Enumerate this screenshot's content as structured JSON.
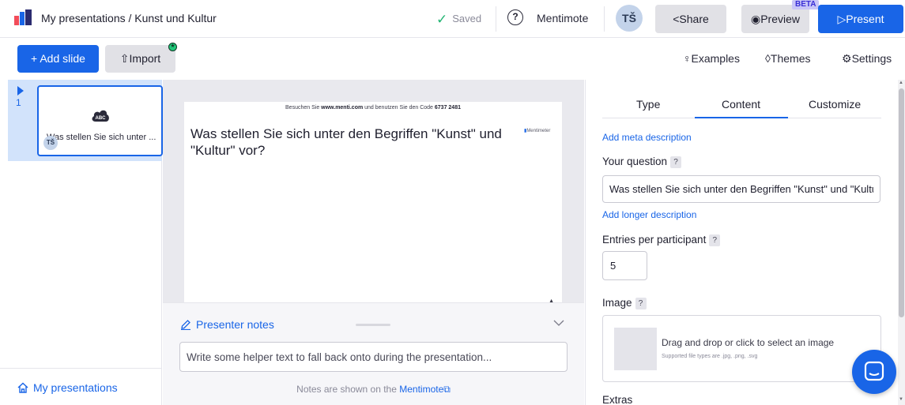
{
  "header": {
    "breadcrumb": "My presentations / Kunst und Kultur",
    "saved": "Saved",
    "mentimote": "Mentimote",
    "avatar_initials": "TŠ",
    "share": "Share",
    "preview": "Preview",
    "beta": "BETA",
    "present": "Present"
  },
  "toolbar": {
    "add_slide": "+ Add slide",
    "import": "Import",
    "examples": "Examples",
    "themes": "Themes",
    "settings": "Settings"
  },
  "slides_panel": {
    "slides": [
      {
        "number": "1",
        "title": "Was stellen Sie sich unter ...",
        "avatar": "TŠ",
        "icon": "cloud-abc-icon",
        "icon_label": "ABC"
      }
    ],
    "my_presentations": "My presentations"
  },
  "slide": {
    "join_prefix": "Besuchen Sie ",
    "join_url": "www.menti.com",
    "join_middle": " und benutzen Sie den Code ",
    "join_code": "6737 2481",
    "question": "Was stellen Sie sich unter den Begriffen \"Kunst\" und \"Kultur\" vor?",
    "brand": "Mentimeter"
  },
  "notes": {
    "title": "Presenter notes",
    "placeholder": "Write some helper text to fall back onto during the presentation...",
    "footer_prefix": "Notes are shown on the ",
    "footer_link": "Mentimote"
  },
  "editor": {
    "tabs": [
      "Type",
      "Content",
      "Customize"
    ],
    "active_tab": "Content",
    "add_meta": "Add meta description",
    "your_question_label": "Your question",
    "question_value": "Was stellen Sie sich unter den Begriffen \"Kunst\" und \"Kultur\" vor?",
    "add_longer": "Add longer description",
    "entries_label": "Entries per participant",
    "entries_value": "5",
    "image_label": "Image",
    "drop_text": "Drag and drop or click to select an image",
    "drop_sub": "Supported file types are .jpg, .png, .svg",
    "extras_label": "Extras",
    "help_mark": "?"
  },
  "colors": {
    "accent": "#1965e7",
    "saved_check": "#22b573",
    "selected_slide_bg": "#d2e3fb"
  }
}
